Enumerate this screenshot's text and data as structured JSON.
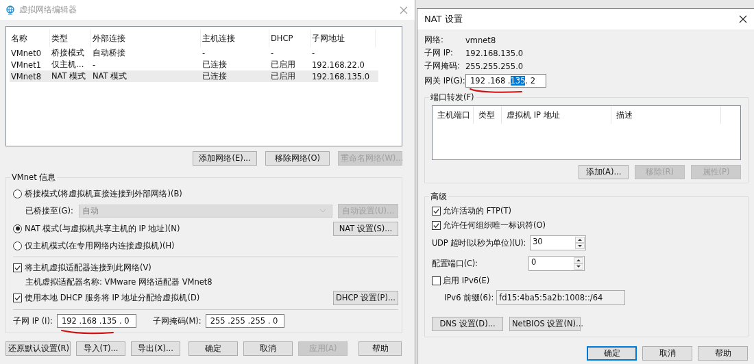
{
  "editor_window": {
    "title": "虚拟网络编辑器",
    "network_table": {
      "columns": [
        "名称",
        "类型",
        "外部连接",
        "主机连接",
        "DHCP",
        "子网地址"
      ],
      "rows": [
        {
          "cells": [
            "VMnet0",
            "桥接模式",
            "自动桥接",
            "-",
            "-",
            "-"
          ],
          "selected": false
        },
        {
          "cells": [
            "VMnet1",
            "仅主机…",
            "-",
            "已连接",
            "已启用",
            "192.168.22.0"
          ],
          "selected": false
        },
        {
          "cells": [
            "VMnet8",
            "NAT 模式",
            "NAT 模式",
            "已连接",
            "已启用",
            "192.168.135.0"
          ],
          "selected": true
        }
      ]
    },
    "list_buttons": [
      {
        "label": "添加网络(E)...",
        "disabled": false
      },
      {
        "label": "移除网络(O)",
        "disabled": false
      },
      {
        "label": "重命名网络(W)...",
        "disabled": true
      }
    ],
    "vmnet_info": {
      "title": "VMnet 信息",
      "bridge_mode": {
        "label": "桥接模式(将虚拟机直接连接到外部网络)(B)",
        "selected": false
      },
      "bridged_to": {
        "label": "已桥接至(G):",
        "value": "自动",
        "disabled": true
      },
      "auto_settings_button": {
        "label": "自动设置(U)...",
        "disabled": true
      },
      "nat_mode": {
        "label": "NAT 模式(与虚拟机共享主机的 IP 地址)(N)",
        "selected": true
      },
      "nat_settings_button": {
        "label": "NAT 设置(S)...",
        "disabled": false
      },
      "host_only_mode": {
        "label": "仅主机模式(在专用网络内连接虚拟机)(H)",
        "selected": false
      },
      "connect_adapter": {
        "label": "将主机虚拟适配器连接到此网络(V)",
        "checked": true
      },
      "adapter_name": "主机虚拟适配器名称: VMware 网络适配器 VMnet8",
      "use_dhcp": {
        "label": "使用本地 DHCP 服务将 IP 地址分配给虚拟机(D)",
        "checked": true
      },
      "dhcp_button": {
        "label": "DHCP 设置(P)...",
        "disabled": false
      },
      "subnet_ip": {
        "label": "子网 IP (I):",
        "value": "192 .168 .135 . 0"
      },
      "subnet_mask": {
        "label": "子网掩码(M):",
        "value": "255 .255 .255 . 0"
      }
    },
    "buttons": [
      {
        "label": "还原默认设置(R)",
        "disabled": false
      },
      {
        "label": "导入(T)...",
        "disabled": false
      },
      {
        "label": "导出(X)...",
        "disabled": false
      },
      {
        "label": "确定",
        "disabled": false
      },
      {
        "label": "取消",
        "disabled": false
      },
      {
        "label": "应用(A)",
        "disabled": true
      },
      {
        "label": "帮助",
        "disabled": false
      }
    ]
  },
  "nat_dialog": {
    "title": "NAT 设置",
    "info": [
      {
        "label": "网络:",
        "value": "vmnet8"
      },
      {
        "label": "子网 IP:",
        "value": "192.168.135.0"
      },
      {
        "label": "子网掩码:",
        "value": "255.255.255.0"
      }
    ],
    "gateway": {
      "label": "网关 IP(G):",
      "parts": [
        {
          "text": "192 .",
          "selected": false
        },
        {
          "text": "168 .",
          "selected": false
        },
        {
          "text": "135",
          "selected": true
        },
        {
          "text": ". 2",
          "selected": false
        }
      ]
    },
    "port_forwarding": {
      "title": "端口转发(F)",
      "columns": [
        "主机端口",
        "类型",
        "虚拟机 IP 地址",
        "描述"
      ],
      "buttons": [
        {
          "label": "添加(A)...",
          "disabled": false
        },
        {
          "label": "移除(R)",
          "disabled": true
        },
        {
          "label": "属性(P)",
          "disabled": true
        }
      ]
    },
    "advanced": {
      "title": "高级",
      "items": [
        {
          "kind": "checkbox",
          "label": "允许活动的 FTP(T)",
          "checked": true
        },
        {
          "kind": "checkbox",
          "label": "允许任何组织唯一标识符(O)",
          "checked": true
        },
        {
          "kind": "spinner",
          "label": "UDP 超时(以秒为单位)(U):",
          "value": "30"
        },
        {
          "kind": "spinner",
          "label": "配置端口(C):",
          "value": "0"
        },
        {
          "kind": "checkbox",
          "label": "启用 IPv6(E)",
          "checked": false
        },
        {
          "kind": "field",
          "label": "IPv6 前缀(6):",
          "value": "fd15:4ba5:5a2b:1008::/64"
        }
      ],
      "buttons": [
        "DNS 设置(D)...",
        "NetBIOS 设置(N)..."
      ]
    },
    "buttons": [
      {
        "label": "确定",
        "default": true
      },
      {
        "label": "取消",
        "default": false
      },
      {
        "label": "帮助",
        "default": false
      }
    ]
  }
}
